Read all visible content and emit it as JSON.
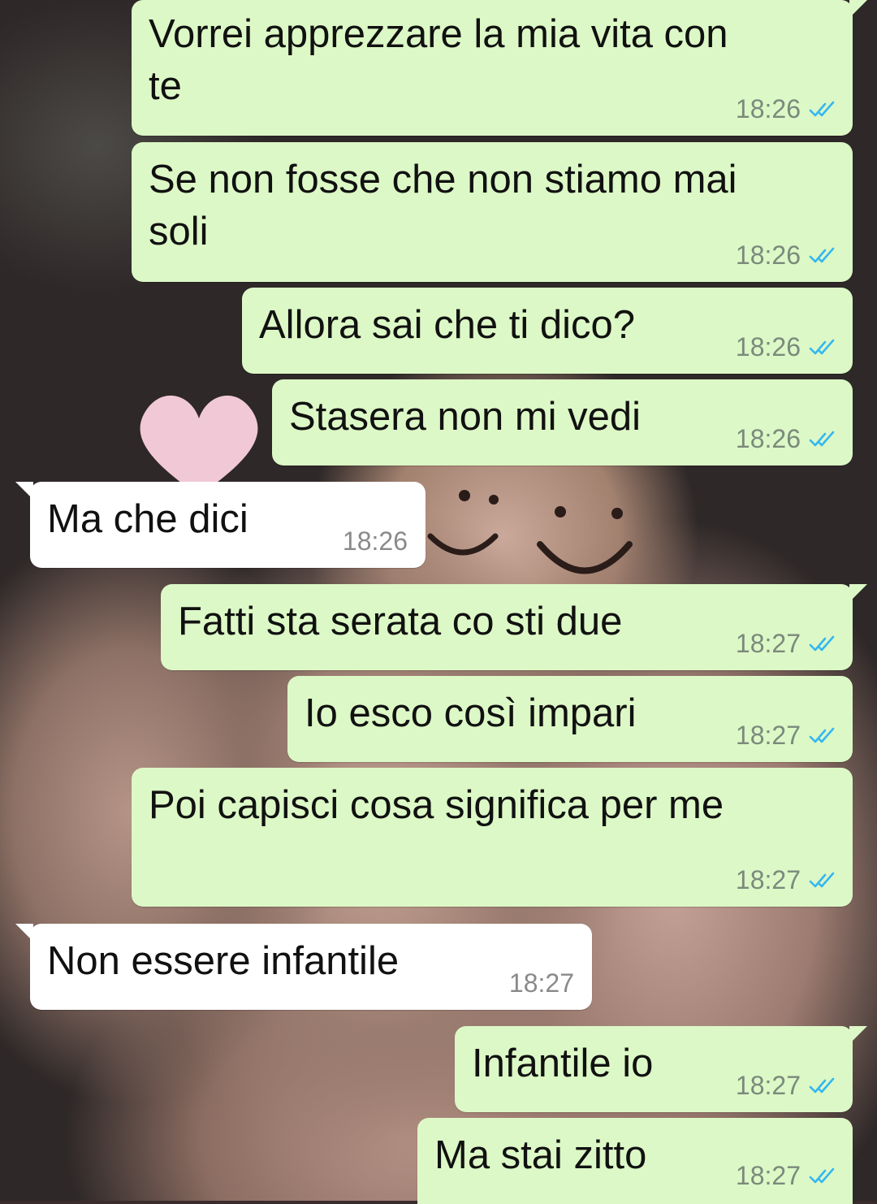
{
  "theme": {
    "outgoing_bubble": "#dcf8c6",
    "incoming_bubble": "#ffffff",
    "read_tick_color": "#34b7f1",
    "timestamp_color": "#7b8a7c"
  },
  "messages": [
    {
      "direction": "out",
      "text": "Vorrei apprezzare la mia vita con\nte",
      "time": "18:26",
      "status": "read"
    },
    {
      "direction": "out",
      "text": "Se non fosse che non stiamo mai\nsoli",
      "time": "18:26",
      "status": "read"
    },
    {
      "direction": "out",
      "text": "Allora sai che ti dico?",
      "time": "18:26",
      "status": "read"
    },
    {
      "direction": "out",
      "text": "Stasera non mi vedi",
      "time": "18:26",
      "status": "read"
    },
    {
      "direction": "in",
      "text": "Ma che dici",
      "time": "18:26"
    },
    {
      "direction": "out",
      "text": "Fatti sta serata co sti due",
      "time": "18:27",
      "status": "read"
    },
    {
      "direction": "out",
      "text": "Io esco così impari",
      "time": "18:27",
      "status": "read"
    },
    {
      "direction": "out",
      "text": "Poi capisci cosa significa per me",
      "time": "18:27",
      "status": "read"
    },
    {
      "direction": "in",
      "text": "Non essere infantile",
      "time": "18:27"
    },
    {
      "direction": "out",
      "text": "Infantile io",
      "time": "18:27",
      "status": "read"
    },
    {
      "direction": "out",
      "text": "Ma stai zitto",
      "time": "18:27",
      "status": "read"
    }
  ],
  "wallpaper": {
    "icons": [
      "heart-icon",
      "smiley-face-icon"
    ]
  }
}
